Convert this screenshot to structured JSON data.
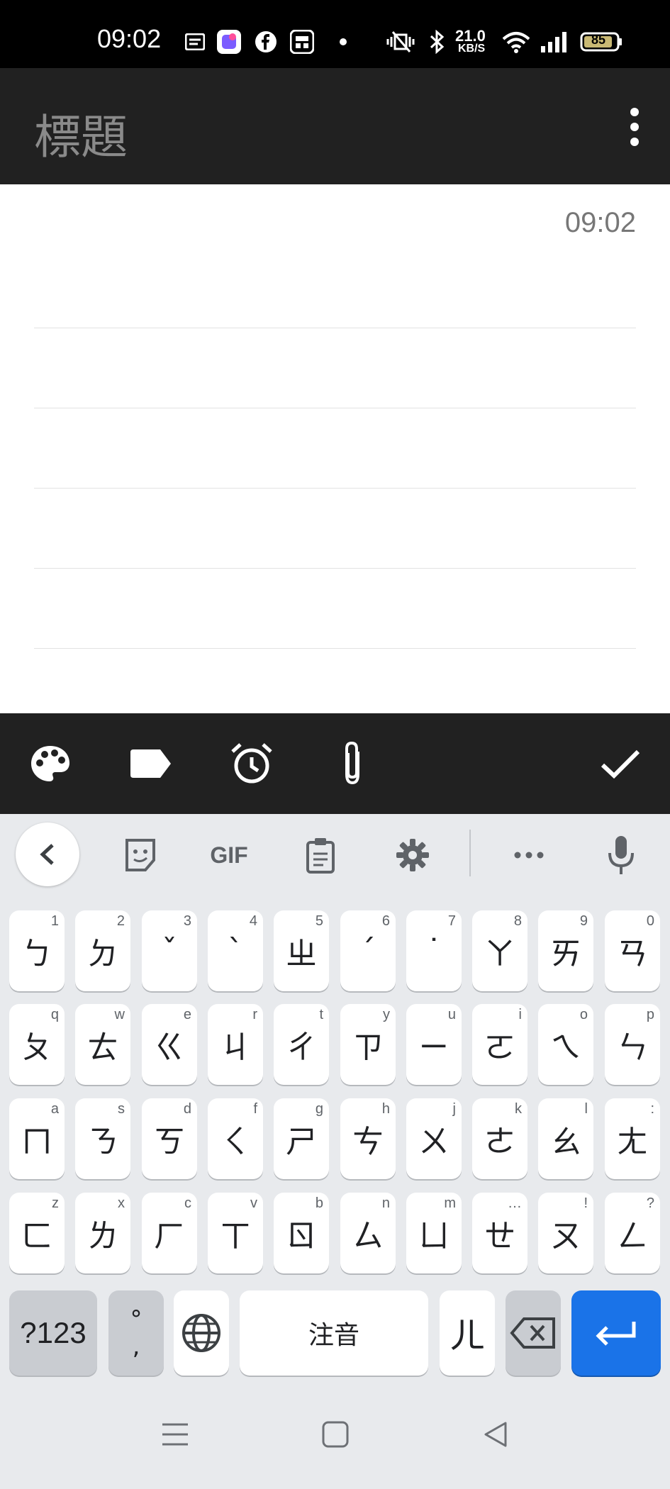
{
  "status_bar": {
    "time": "09:02",
    "net_speed_value": "21.0",
    "net_speed_unit": "KB/S",
    "battery": "85"
  },
  "app_bar": {
    "title": "標題"
  },
  "note": {
    "timestamp": "09:02"
  },
  "keyboard": {
    "toolbar": {
      "gif_label": "GIF"
    },
    "rows": [
      [
        {
          "main": "ㄅ",
          "hint": "1"
        },
        {
          "main": "ㄉ",
          "hint": "2"
        },
        {
          "main": "ˇ",
          "hint": "3"
        },
        {
          "main": "ˋ",
          "hint": "4"
        },
        {
          "main": "ㄓ",
          "hint": "5"
        },
        {
          "main": "ˊ",
          "hint": "6"
        },
        {
          "main": "˙",
          "hint": "7"
        },
        {
          "main": "ㄚ",
          "hint": "8"
        },
        {
          "main": "ㄞ",
          "hint": "9"
        },
        {
          "main": "ㄢ",
          "hint": "0"
        }
      ],
      [
        {
          "main": "ㄆ",
          "hint": "q"
        },
        {
          "main": "ㄊ",
          "hint": "w"
        },
        {
          "main": "ㄍ",
          "hint": "e"
        },
        {
          "main": "ㄐ",
          "hint": "r"
        },
        {
          "main": "ㄔ",
          "hint": "t"
        },
        {
          "main": "ㄗ",
          "hint": "y"
        },
        {
          "main": "ㄧ",
          "hint": "u"
        },
        {
          "main": "ㄛ",
          "hint": "i"
        },
        {
          "main": "ㄟ",
          "hint": "o"
        },
        {
          "main": "ㄣ",
          "hint": "p"
        }
      ],
      [
        {
          "main": "ㄇ",
          "hint": "a"
        },
        {
          "main": "ㄋ",
          "hint": "s"
        },
        {
          "main": "ㄎ",
          "hint": "d"
        },
        {
          "main": "ㄑ",
          "hint": "f"
        },
        {
          "main": "ㄕ",
          "hint": "g"
        },
        {
          "main": "ㄘ",
          "hint": "h"
        },
        {
          "main": "ㄨ",
          "hint": "j"
        },
        {
          "main": "ㄜ",
          "hint": "k"
        },
        {
          "main": "ㄠ",
          "hint": "l"
        },
        {
          "main": "ㄤ",
          "hint": ":"
        }
      ],
      [
        {
          "main": "ㄈ",
          "hint": "z"
        },
        {
          "main": "ㄌ",
          "hint": "x"
        },
        {
          "main": "ㄏ",
          "hint": "c"
        },
        {
          "main": "ㄒ",
          "hint": "v"
        },
        {
          "main": "ㄖ",
          "hint": "b"
        },
        {
          "main": "ㄙ",
          "hint": "n"
        },
        {
          "main": "ㄩ",
          "hint": "m"
        },
        {
          "main": "ㄝ",
          "hint": "…"
        },
        {
          "main": "ㄡ",
          "hint": "!"
        },
        {
          "main": "ㄥ",
          "hint": "?"
        }
      ]
    ],
    "bottom": {
      "symbols_label": "?123",
      "punct_top": "°",
      "punct_bottom": ",",
      "space_label": "注音",
      "er_label": "ㄦ"
    }
  },
  "colors": {
    "app_bar_bg": "#212121",
    "keyboard_bg": "#e8eaed",
    "enter_key": "#1a73e8",
    "function_key": "#c9ccd1"
  }
}
